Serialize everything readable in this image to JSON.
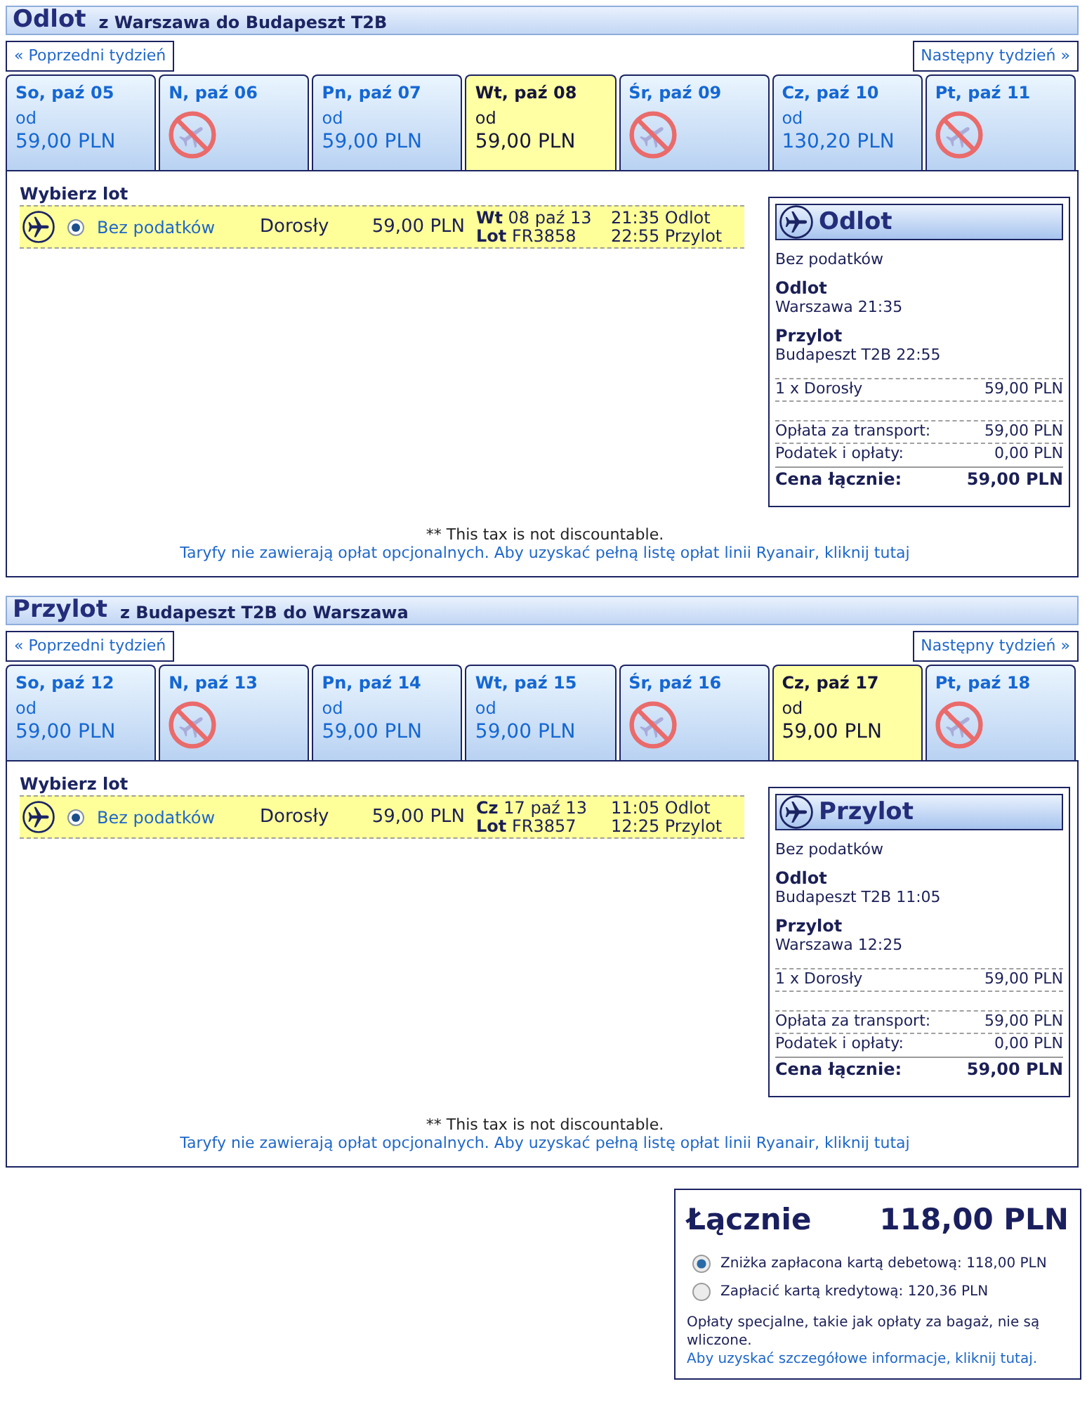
{
  "sections": [
    {
      "title": "Odlot",
      "route": "z Warszawa do Budapeszt T2B",
      "prev_week": "« Poprzedni tydzień",
      "next_week": "Następny tydzień »",
      "days": [
        {
          "label": "So, paź 05",
          "available": true,
          "from": "od",
          "price": "59,00 PLN",
          "selected": false
        },
        {
          "label": "N, paź 06",
          "available": false,
          "selected": false
        },
        {
          "label": "Pn, paź 07",
          "available": true,
          "from": "od",
          "price": "59,00 PLN",
          "selected": false
        },
        {
          "label": "Wt, paź 08",
          "available": true,
          "from": "od",
          "price": "59,00 PLN",
          "selected": true
        },
        {
          "label": "Śr, paź 09",
          "available": false,
          "selected": false
        },
        {
          "label": "Cz, paź 10",
          "available": true,
          "from": "od",
          "price": "130,20 PLN",
          "selected": false
        },
        {
          "label": "Pt, paź 11",
          "available": false,
          "selected": false
        }
      ],
      "choose_label": "Wybierz lot",
      "flights": [
        {
          "selected": true,
          "fare": "Bez podatków",
          "passenger": "Dorosły",
          "price": "59,00 PLN",
          "date": "**Wt** 08 paź 13",
          "flight": "**Lot** FR3858",
          "departure": "21:35 Odlot",
          "arrival": "22:55 Przylot"
        }
      ],
      "summary": {
        "title": "Odlot",
        "fare": "Bez podatków",
        "departure_label": "Odlot",
        "departure": "Warszawa 21:35",
        "arrival_label": "Przylot",
        "arrival": "Budapeszt T2B 22:55",
        "passengers": [
          {
            "label": "1 x Dorosły",
            "value": "59,00 PLN"
          }
        ],
        "charges": [
          {
            "label": "Opłata za transport:",
            "value": "59,00 PLN"
          },
          {
            "label": "Podatek i opłaty:",
            "value": "0,00 PLN"
          }
        ],
        "total_label": "Cena łącznie:",
        "total": "59,00 PLN"
      },
      "tax_note": "** This tax is not discountable.",
      "fees_link": "Taryfy nie zawierają opłat opcjonalnych. Aby uzyskać pełną listę opłat linii Ryanair, kliknij tutaj"
    },
    {
      "title": "Przylot",
      "route": "z Budapeszt T2B do Warszawa",
      "prev_week": "« Poprzedni tydzień",
      "next_week": "Następny tydzień »",
      "days": [
        {
          "label": "So, paź 12",
          "available": true,
          "from": "od",
          "price": "59,00 PLN",
          "selected": false
        },
        {
          "label": "N, paź 13",
          "available": false,
          "selected": false
        },
        {
          "label": "Pn, paź 14",
          "available": true,
          "from": "od",
          "price": "59,00 PLN",
          "selected": false
        },
        {
          "label": "Wt, paź 15",
          "available": true,
          "from": "od",
          "price": "59,00 PLN",
          "selected": false
        },
        {
          "label": "Śr, paź 16",
          "available": false,
          "selected": false
        },
        {
          "label": "Cz, paź 17",
          "available": true,
          "from": "od",
          "price": "59,00 PLN",
          "selected": true
        },
        {
          "label": "Pt, paź 18",
          "available": false,
          "selected": false
        }
      ],
      "choose_label": "Wybierz lot",
      "flights": [
        {
          "selected": true,
          "fare": "Bez podatków",
          "passenger": "Dorosły",
          "price": "59,00 PLN",
          "date": "**Cz** 17 paź 13",
          "flight": "**Lot** FR3857",
          "departure": "11:05 Odlot",
          "arrival": "12:25 Przylot"
        }
      ],
      "summary": {
        "title": "Przylot",
        "fare": "Bez podatków",
        "departure_label": "Odlot",
        "departure": "Budapeszt T2B 11:05",
        "arrival_label": "Przylot",
        "arrival": "Warszawa 12:25",
        "passengers": [
          {
            "label": "1 x Dorosły",
            "value": "59,00 PLN"
          }
        ],
        "charges": [
          {
            "label": "Opłata za transport:",
            "value": "59,00 PLN"
          },
          {
            "label": "Podatek i opłaty:",
            "value": "0,00 PLN"
          }
        ],
        "total_label": "Cena łącznie:",
        "total": "59,00 PLN"
      },
      "tax_note": "** This tax is not discountable.",
      "fees_link": "Taryfy nie zawierają opłat opcjonalnych. Aby uzyskać pełną listę opłat linii Ryanair, kliknij tutaj"
    }
  ],
  "total": {
    "label": "Łącznie",
    "amount": "118,00 PLN",
    "payment_options": [
      {
        "text": "Zniżka zapłacona kartą debetową: 118,00 PLN",
        "selected": true
      },
      {
        "text": "Zapłacić kartą kredytową: 120,36 PLN",
        "selected": false
      }
    ],
    "note": "Opłaty specjalne, takie jak opłaty za bagaż, nie są wliczone.",
    "link": "Aby uzyskać szczegółowe informacje, kliknij tutaj."
  }
}
